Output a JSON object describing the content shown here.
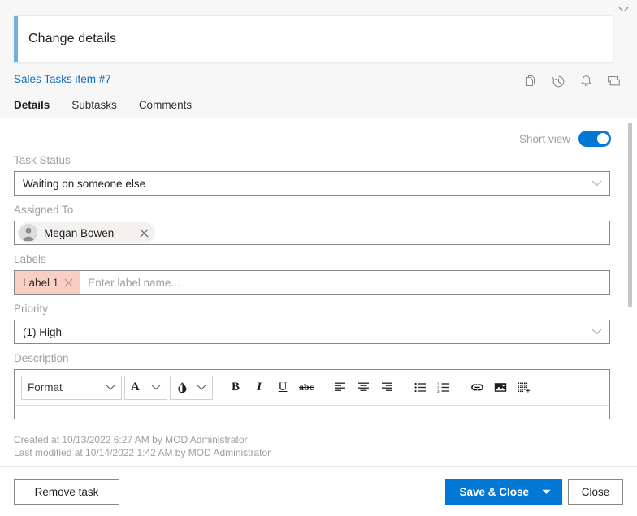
{
  "window": {
    "close_icon": "close-icon"
  },
  "header": {
    "title": "Change details",
    "accent_color": "#71afe5"
  },
  "subheader": {
    "item_link": "Sales Tasks item #7",
    "icons": [
      {
        "name": "copy-icon",
        "title": "Copy"
      },
      {
        "name": "history-icon",
        "title": "Version history"
      },
      {
        "name": "alert-icon",
        "title": "Alert me"
      },
      {
        "name": "card-icon",
        "title": "Card view"
      }
    ],
    "tabs": [
      {
        "label": "Details",
        "active": true
      },
      {
        "label": "Subtasks",
        "active": false
      },
      {
        "label": "Comments",
        "active": false
      }
    ]
  },
  "form": {
    "short_view": {
      "label": "Short view",
      "on": true,
      "accent_color": "#0078d4"
    },
    "task_status": {
      "label": "Task Status",
      "value": "Waiting on someone else"
    },
    "assigned_to": {
      "label": "Assigned To",
      "person": "Megan Bowen"
    },
    "labels": {
      "label": "Labels",
      "chips": [
        {
          "text": "Label 1",
          "color": "#f9cfc4"
        }
      ],
      "placeholder": "Enter label name..."
    },
    "priority": {
      "label": "Priority",
      "value": "(1) High"
    },
    "description": {
      "label": "Description",
      "toolbar": {
        "format_label": "Format",
        "font_color_label": "A",
        "highlight_label": "highlight",
        "buttons": [
          {
            "name": "bold-icon",
            "label": "B"
          },
          {
            "name": "italic-icon",
            "label": "I"
          },
          {
            "name": "underline-icon",
            "label": "U"
          },
          {
            "name": "strikethrough-icon",
            "label": "abc"
          },
          {
            "name": "align-left-icon",
            "label": ""
          },
          {
            "name": "align-center-icon",
            "label": ""
          },
          {
            "name": "align-right-icon",
            "label": ""
          },
          {
            "name": "bulleted-list-icon",
            "label": ""
          },
          {
            "name": "numbered-list-icon",
            "label": ""
          },
          {
            "name": "link-icon",
            "label": ""
          },
          {
            "name": "image-icon",
            "label": ""
          },
          {
            "name": "insert-table-icon",
            "label": ""
          }
        ]
      },
      "content": ""
    }
  },
  "meta": {
    "created": "Created at 10/13/2022 6:27 AM by MOD Administrator",
    "modified": "Last modified at 10/14/2022 1:42 AM by MOD Administrator"
  },
  "actions": {
    "remove": "Remove task",
    "save_close": "Save & Close",
    "close": "Close"
  }
}
